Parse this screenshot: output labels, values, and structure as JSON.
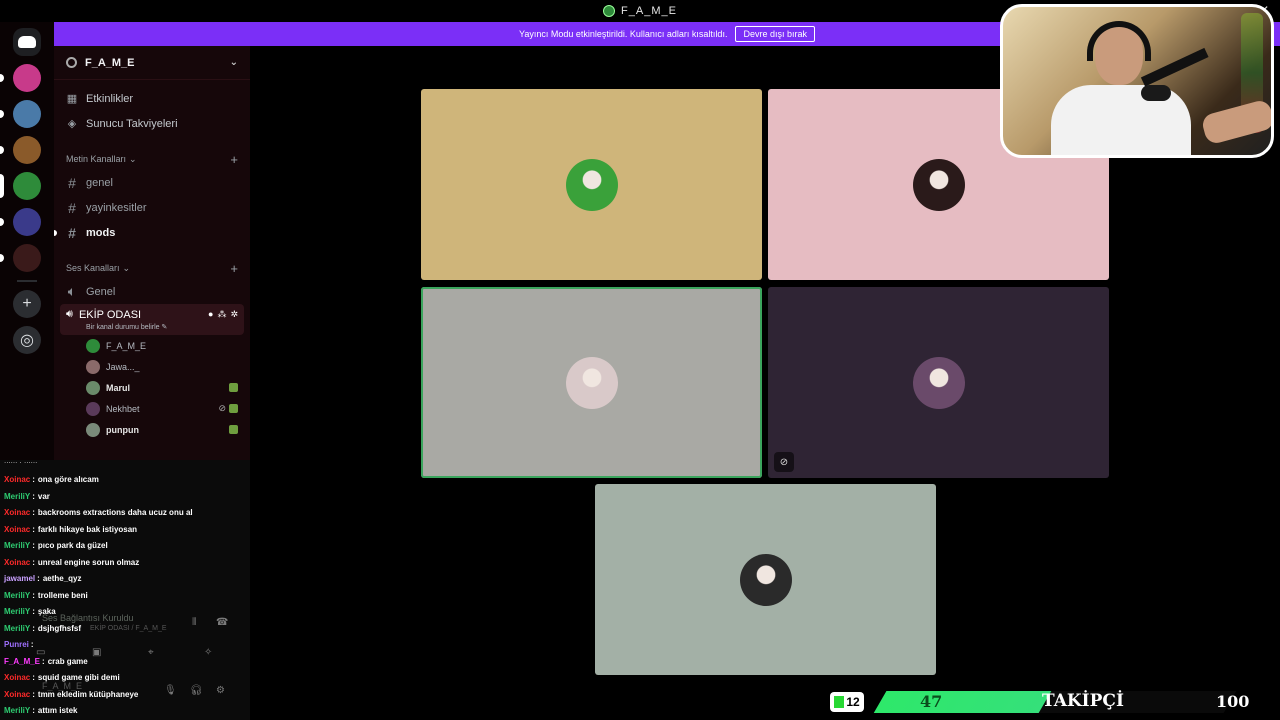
{
  "window": {
    "title": "F_A_M_E",
    "close_glyph": "✕"
  },
  "banner": {
    "text": "Yayıncı Modu etkinleştirildi. Kullanıcı adları kısaltıldı.",
    "button": "Devre dışı bırak"
  },
  "server": {
    "name": "F_A_M_E",
    "nav": [
      {
        "label": "Etkinlikler",
        "icon": "calendar-icon"
      },
      {
        "label": "Sunucu Takviyeleri",
        "icon": "boost-icon"
      }
    ],
    "text_category": "Metin Kanalları",
    "text_channels": [
      {
        "name": "genel",
        "bold": false
      },
      {
        "name": "yayinkesitler",
        "bold": false
      },
      {
        "name": "mods",
        "bold": true
      }
    ],
    "voice_category": "Ses Kanalları",
    "voice_channels": [
      {
        "name": "Genel"
      }
    ],
    "active_voice": {
      "name": "EKİP ODASI",
      "status": "Bir kanal durumu belirle",
      "members": [
        {
          "name": "F_A_M_E",
          "bold": false,
          "muted": false,
          "activity": false,
          "color": "#2e8b3a"
        },
        {
          "name": "Jawa..._",
          "bold": false,
          "muted": false,
          "activity": false,
          "color": "#8a6a6a"
        },
        {
          "name": "Marul",
          "bold": true,
          "muted": false,
          "activity": true,
          "color": "#6a8a6a"
        },
        {
          "name": "Nekhbet",
          "bold": false,
          "muted": true,
          "activity": true,
          "color": "#5a3a5a"
        },
        {
          "name": "punpun",
          "bold": true,
          "muted": false,
          "activity": true,
          "color": "#7a8a7a"
        }
      ]
    }
  },
  "chat": {
    "cut_line": "...... : ......",
    "lines": [
      {
        "user": "Xoinac",
        "cls": "u-xoinac",
        "text": "ona göre alıcam"
      },
      {
        "user": "MeriliY",
        "cls": "u-meriliy",
        "text": "var"
      },
      {
        "user": "Xoinac",
        "cls": "u-xoinac",
        "text": "backrooms extractions daha ucuz onu al"
      },
      {
        "user": "Xoinac",
        "cls": "u-xoinac",
        "text": "farklı hikaye bak istiyosan"
      },
      {
        "user": "MeriliY",
        "cls": "u-meriliy",
        "text": "pıco park da güzel"
      },
      {
        "user": "Xoinac",
        "cls": "u-xoinac",
        "text": "unreal engine sorun olmaz"
      },
      {
        "user": "jawamel",
        "cls": "u-jawamel",
        "text": "aethe_qyz"
      },
      {
        "user": "MeriliY",
        "cls": "u-meriliy",
        "text": "trolleme beni"
      },
      {
        "user": "MeriliY",
        "cls": "u-meriliy",
        "text": "şaka"
      },
      {
        "user": "MeriliY",
        "cls": "u-meriliy",
        "text": "dsjhgfhsfsf"
      },
      {
        "user": "Punrei",
        "cls": "u-punrei",
        "text": ""
      },
      {
        "user": "F_A_M_E",
        "cls": "u-fame",
        "text": "crab game"
      },
      {
        "user": "Xoinac",
        "cls": "u-xoinac",
        "text": "squid game gibi demi"
      },
      {
        "user": "Xoinac",
        "cls": "u-xoinac",
        "text": "tmm ekledim kütüphaneye"
      },
      {
        "user": "MeriliY",
        "cls": "u-meriliy",
        "text": "attım istek"
      }
    ],
    "sep": ":"
  },
  "connection": {
    "title": "Ses Bağlantısı Kuruldu",
    "subtitle": "EKİP ODASI / F_A_M_E",
    "user": "F_A_M_E"
  },
  "tiles": [
    {
      "name": "tile-fame",
      "bg": "#cfb57a",
      "avatar": "#3aa13a",
      "speaking": false,
      "muted": false
    },
    {
      "name": "tile-jawa",
      "bg": "#e6bcc2",
      "avatar": "#2a1a1a",
      "speaking": false,
      "muted": false
    },
    {
      "name": "tile-marul",
      "bg": "#a9a9a4",
      "avatar": "#d9c9c9",
      "speaking": true,
      "muted": false
    },
    {
      "name": "tile-nekhbet",
      "bg": "#2f2434",
      "avatar": "#6a4a6a",
      "speaking": false,
      "muted": true
    },
    {
      "name": "tile-punpun",
      "bg": "#a3b0a6",
      "avatar": "#2a2a2a",
      "speaking": false,
      "muted": false
    }
  ],
  "followers": {
    "badge": "12",
    "current": 47,
    "label": "TAKİPÇİ",
    "goal": 100
  }
}
